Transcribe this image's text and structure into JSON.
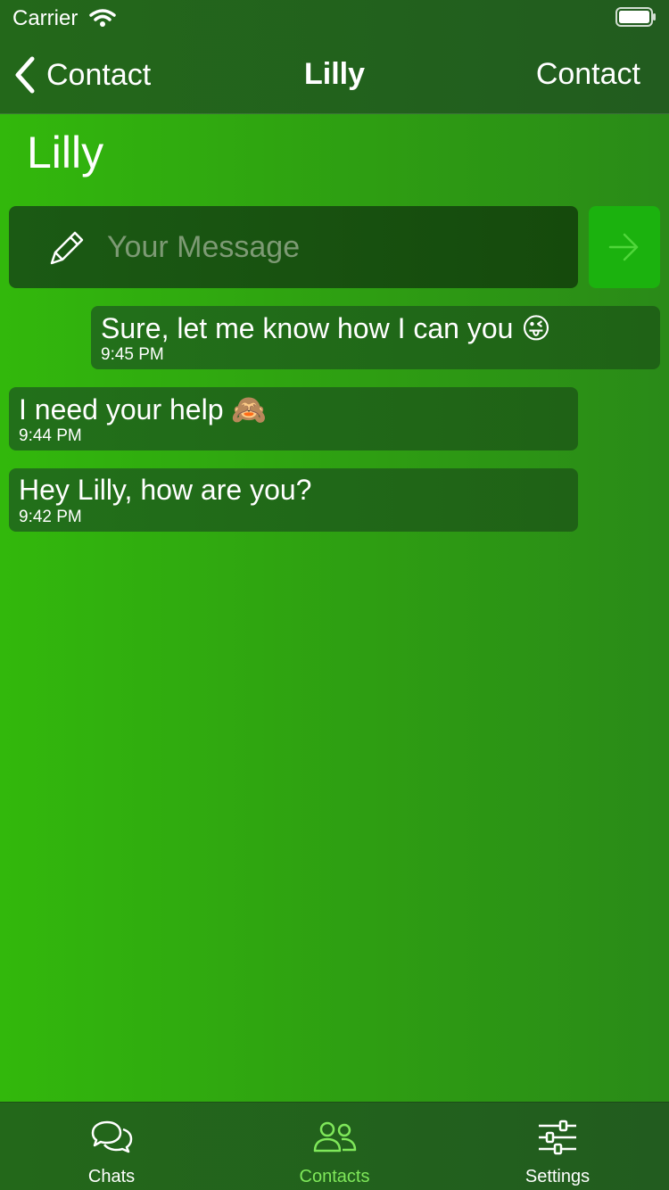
{
  "status_bar": {
    "carrier": "Carrier"
  },
  "nav": {
    "back_label": "Contact",
    "title": "Lilly",
    "right_label": "Contact"
  },
  "contact_name": "Lilly",
  "compose": {
    "placeholder": "Your Message",
    "value": ""
  },
  "messages": [
    {
      "text": "Sure, let me know how I can you",
      "emoji": "😜",
      "time": "9:45 PM",
      "direction": "outgoing"
    },
    {
      "text": "I need your help",
      "emoji": "🙈",
      "time": "9:44 PM",
      "direction": "incoming"
    },
    {
      "text": "Hey Lilly, how are you?",
      "emoji": "",
      "time": "9:42 PM",
      "direction": "incoming"
    }
  ],
  "tabs": [
    {
      "label": "Chats",
      "icon": "chat-bubbles-icon",
      "active": false
    },
    {
      "label": "Contacts",
      "icon": "contacts-icon",
      "active": true
    },
    {
      "label": "Settings",
      "icon": "sliders-icon",
      "active": false
    }
  ],
  "colors": {
    "accent": "#7fe85a",
    "send_button": "#1bb20e",
    "background": "#32b80c"
  }
}
